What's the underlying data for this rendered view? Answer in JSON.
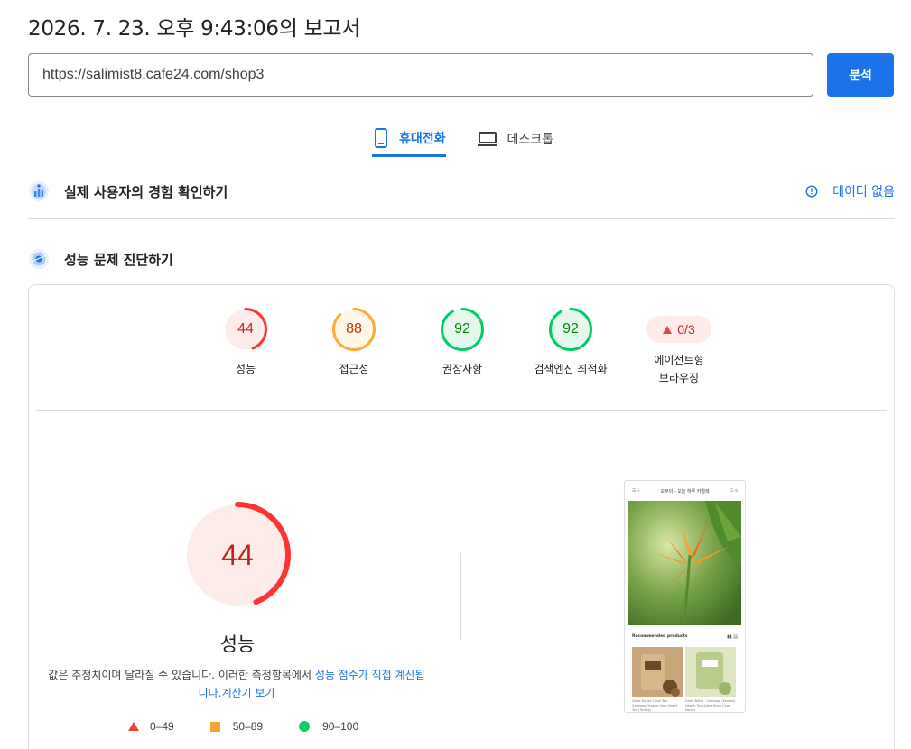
{
  "report": {
    "title": "2026. 7. 23. 오후 9:43:06의 보고서"
  },
  "url_bar": {
    "value": "https://salimist8.cafe24.com/shop3",
    "analyze_label": "분석"
  },
  "tabs": [
    {
      "label": "휴대전화",
      "icon": "mobile-phone-icon",
      "active": true
    },
    {
      "label": "데스크톱",
      "icon": "laptop-icon",
      "active": false
    }
  ],
  "crux": {
    "title": "실제 사용자의 경험 확인하기",
    "no_data_label": "데이터 없음",
    "icon": "crux-icon"
  },
  "diagnostics": {
    "title": "성능 문제 진단하기",
    "icon": "lighthouse-icon"
  },
  "categories": [
    {
      "label": "성능",
      "score": 44,
      "color": "#ff3333",
      "bg": "#fdecea",
      "text_color": "#c5221f"
    },
    {
      "label": "접근성",
      "score": 88,
      "color": "#ffaa33",
      "bg": "#fff7e8",
      "text_color": "#c33300"
    },
    {
      "label": "권장사항",
      "score": 92,
      "color": "#00cc66",
      "bg": "#e6f8ee",
      "text_color": "#008800"
    },
    {
      "label": "검색엔진 최적화",
      "score": 92,
      "color": "#00cc66",
      "bg": "#e6f8ee",
      "text_color": "#008800"
    }
  ],
  "agentic": {
    "label_line1": "에이전트형",
    "label_line2": "브라우징",
    "value": "0/3"
  },
  "performance": {
    "score": 44,
    "label": "성능",
    "desc_prefix": "값은 추정치이며 달라질 수 있습니다. 이러한 측정항목에서 ",
    "desc_link1": "성능 점수가 직접 계산됩니다.",
    "desc_link2": "계산기 보기"
  },
  "legend": [
    {
      "range": "0–49",
      "shape": "triangle",
      "color": "#e8453c"
    },
    {
      "range": "50–89",
      "shape": "square",
      "color": "#f4a633"
    },
    {
      "range": "90–100",
      "shape": "circle",
      "color": "#0cce6b"
    }
  ],
  "screenshot": {
    "header_title": "오부이 - 오늘 하루 카멀레",
    "section_title": "Recommended products",
    "product1_caption": "Dried Honey Olive Tea · Collagen Organic Non-Health Tea (Turkey)",
    "product2_caption": "Dried Bitter · Cabbage (Korean) Health Tea (Lion+Bean Care Korea)"
  }
}
